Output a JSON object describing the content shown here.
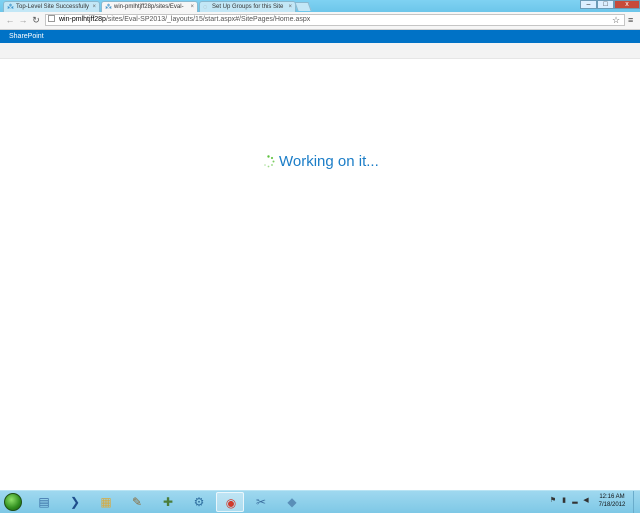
{
  "browser": {
    "tabs": [
      {
        "label": "Top-Level Site Successfully",
        "active": false
      },
      {
        "label": "win-pmlhtjff28p/sites/Eval-",
        "active": true
      },
      {
        "label": "Set Up Groups for this Site",
        "active": false
      }
    ],
    "tab_close": "×",
    "window_controls": {
      "minimize": "–",
      "maximize": "□",
      "close": "x"
    },
    "url_host": "win-pmlhtjff28p",
    "url_path": "/sites/Eval-SP2013/_layouts/15/start.aspx#/SitePages/Home.aspx"
  },
  "suitebar": {
    "brand": "SharePoint",
    "color": "#0072c6"
  },
  "main": {
    "status_text": "Working on it...",
    "accent": "#1b7dc7",
    "spinner_color": "#5cc13b"
  },
  "taskbar": {
    "apps": [
      {
        "name": "server-manager-icon",
        "glyph": "▤",
        "color": "#3a6ea5",
        "active": false
      },
      {
        "name": "powershell-icon",
        "glyph": "❯",
        "color": "#1f4e8c",
        "active": false
      },
      {
        "name": "file-explorer-icon",
        "glyph": "▦",
        "color": "#d9a93b",
        "active": false
      },
      {
        "name": "tools-icon",
        "glyph": "✎",
        "color": "#8a6a3a",
        "active": false
      },
      {
        "name": "network-tools-icon",
        "glyph": "✚",
        "color": "#4b7d3a",
        "active": false
      },
      {
        "name": "settings-icon",
        "glyph": "⚙",
        "color": "#2f6f9f",
        "active": false
      },
      {
        "name": "chrome-icon",
        "glyph": "◉",
        "color": "#d13a2b",
        "active": true
      },
      {
        "name": "admin-tools-icon",
        "glyph": "✂",
        "color": "#3b6fa0",
        "active": false
      },
      {
        "name": "app-icon",
        "glyph": "◆",
        "color": "#5a8fb8",
        "active": false
      }
    ],
    "time": "12:16 AM",
    "date": "7/18/2012"
  }
}
